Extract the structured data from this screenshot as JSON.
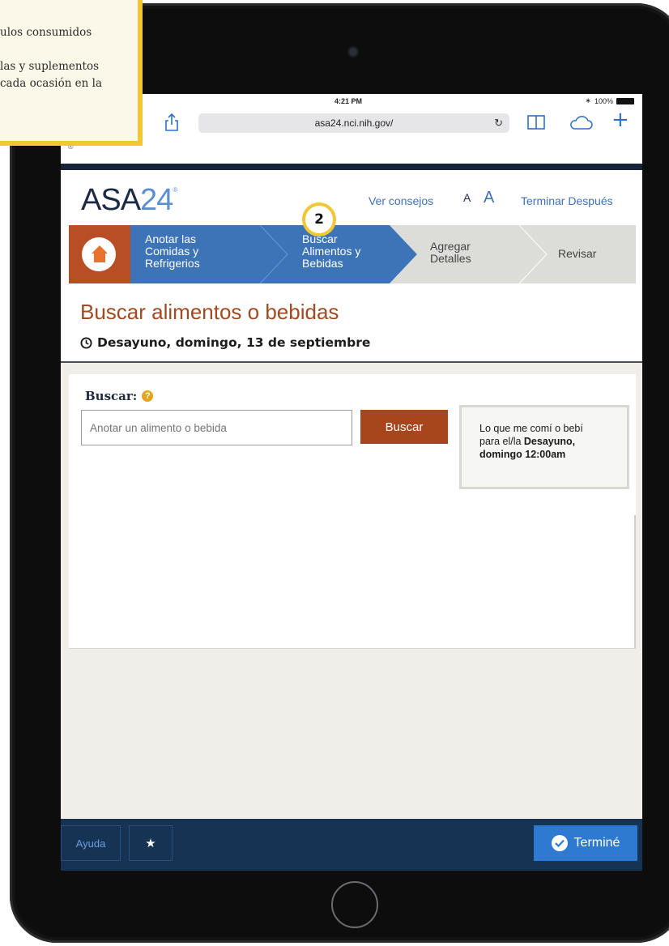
{
  "callout": {
    "line1": "ulos consumidos",
    "line2": "las y suplementos",
    "line3": "cada ocasión en la"
  },
  "status_bar": {
    "time": "4:21 PM",
    "battery": "100%"
  },
  "browser": {
    "url": "asa24.nci.nih.gov/"
  },
  "header": {
    "logo_main": "ASA",
    "logo_num": "24",
    "logo_mark": "®",
    "tips_link": "Ver consejos",
    "font_small": "A",
    "font_large": "A",
    "finish_later": "Terminar Después"
  },
  "steps": {
    "current_number": "2",
    "items": [
      {
        "line1": "Anotar las",
        "line2": "Comidas y",
        "line3": "Refrigerios"
      },
      {
        "line1": "Buscar",
        "line2": "Alimentos y",
        "line3": "Bebidas"
      },
      {
        "line1": "Agregar",
        "line2": "Detalles"
      },
      {
        "line1": "Revisar"
      }
    ]
  },
  "page": {
    "title": "Buscar alimentos o bebidas",
    "meal": "Desayuno, domingo, 13 de septiembre"
  },
  "search": {
    "label": "Buscar:",
    "help": "?",
    "placeholder": "Anotar un alimento o bebida",
    "button": "Buscar"
  },
  "meal_box": {
    "line1": "Lo que me comí o bebí",
    "line2_prefix": "para el/la ",
    "line2_bold": "Desayuno,",
    "line3": "domingo 12:00am"
  },
  "footer": {
    "help": "Ayuda",
    "star": "★",
    "done": "Terminé"
  },
  "colors": {
    "accent_orange": "#a7451d",
    "step_active_blue": "#3d74b8",
    "step_inactive_grey": "#dcdcd9",
    "navy": "#173354",
    "highlight_yellow": "#f1c735"
  }
}
